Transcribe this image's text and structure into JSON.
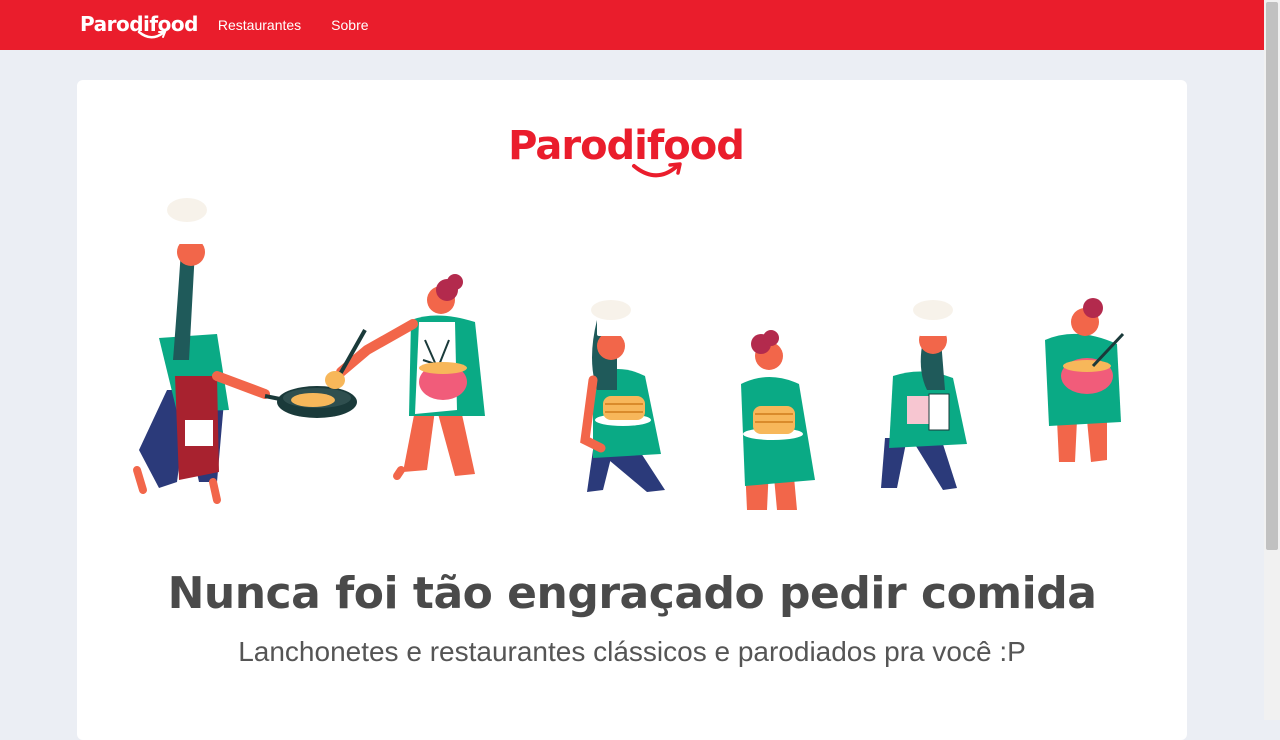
{
  "navbar": {
    "logo": "Parodifood",
    "links": [
      "Restaurantes",
      "Sobre"
    ],
    "color": "#ea1d2c"
  },
  "hero": {
    "logo": "Parodifood",
    "headline": "Nunca foi tão engraçado pedir comida",
    "subheadline": "Lanchonetes e restaurantes clássicos e parodiados pra você :P",
    "illustration": "chefs-cooking-pancakes"
  },
  "colors": {
    "brand": "#ea1d2c",
    "background": "#ebeef4",
    "shirt": "#0aaa85",
    "skin": "#f2664a",
    "pants": "#2b3a7a",
    "hair": "#1f5a5a"
  }
}
